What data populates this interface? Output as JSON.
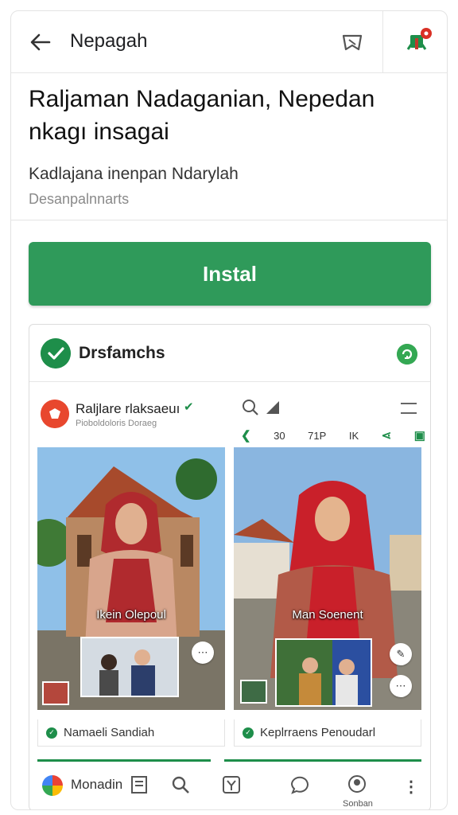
{
  "topbar": {
    "title": "Nepagah",
    "icons": [
      "back-arrow-icon",
      "bookmark-icon",
      "flag-icon"
    ]
  },
  "app": {
    "title": "Raljaman Nadaganian, Nepedan nkagı insagai",
    "developer": "Kadlajana inenpan Ndarylah",
    "subtitle": "Desanpalnnarts",
    "install_label": "Instal",
    "accent": "#2f9a5a"
  },
  "card": {
    "title": "Drsfamchs",
    "post_header": {
      "name": "Raljlare rlaksaeuı",
      "handle": "Pioboldoloris Doraeg",
      "counts": [
        "30",
        "71P",
        "IK"
      ]
    },
    "posts": [
      {
        "caption": "Ikein Olepoul",
        "footer": "Namaeli Sandiah"
      },
      {
        "caption": "Man Soenent",
        "footer": "Keplrraens Penoudarl"
      }
    ]
  },
  "bottom_bar": {
    "label": "Monadin",
    "small_label": "Sonban"
  }
}
